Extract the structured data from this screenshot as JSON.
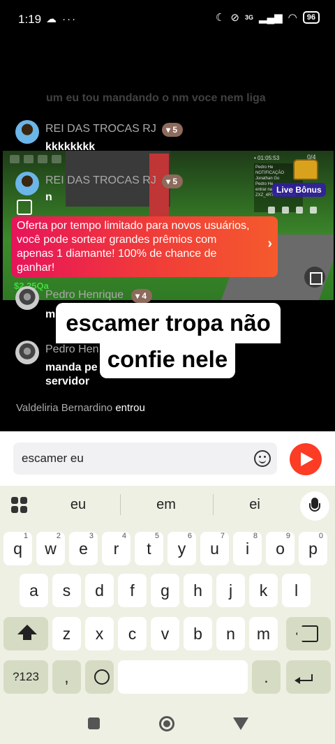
{
  "status_bar": {
    "time": "1:19",
    "left_icons": "☁ ···",
    "network": "3G",
    "battery": "96"
  },
  "chat": {
    "faded_line": "um eu tou mandando o nm voce nem liga",
    "messages": [
      {
        "name": "REI DAS TROCAS  RJ",
        "level": "5",
        "text": "kkkkkkkk"
      },
      {
        "name": "REI DAS TROCAS  RJ",
        "level": "5",
        "text": "n"
      },
      {
        "name": "Pedro Henrique",
        "level": "4",
        "text": "m"
      },
      {
        "name": "Pedro Hen",
        "text_line1": "manda pe",
        "text_line2": "servidor"
      }
    ],
    "game_view": {
      "timer": "• 01:05:53",
      "viewer_count": "0/4",
      "chat_log": "Pedro He\nNOTIFICAÇÃO\nJonathan Go\nPedro He\nentrar na\nZXZ_4RTHUR entrou",
      "live_bonus": "Live Bônus",
      "money": "$2.25Qa"
    },
    "offer": {
      "text": "Oferta por tempo limitado para  novos usuários, você pode sortear grandes prêmios com apenas 1 diamante! 100%  de chance de ganhar!",
      "chevron": "›"
    },
    "caption_line1": "escamer tropa não",
    "caption_line2": "confie nele",
    "join": {
      "name": "Valdeliria Bernardino",
      "word": "entrou"
    }
  },
  "input": {
    "value": "escamer eu"
  },
  "keyboard": {
    "suggestions": [
      "eu",
      "em",
      "ei"
    ],
    "row1": [
      {
        "k": "q",
        "n": "1"
      },
      {
        "k": "w",
        "n": "2"
      },
      {
        "k": "e",
        "n": "3"
      },
      {
        "k": "r",
        "n": "4"
      },
      {
        "k": "t",
        "n": "5"
      },
      {
        "k": "y",
        "n": "6"
      },
      {
        "k": "u",
        "n": "7"
      },
      {
        "k": "i",
        "n": "8"
      },
      {
        "k": "o",
        "n": "9"
      },
      {
        "k": "p",
        "n": "0"
      }
    ],
    "row2": [
      "a",
      "s",
      "d",
      "f",
      "g",
      "h",
      "j",
      "k",
      "l"
    ],
    "row3": [
      "z",
      "x",
      "c",
      "v",
      "b",
      "n",
      "m"
    ],
    "row4": {
      "symbols": "?123",
      "comma": ",",
      "period": "."
    }
  }
}
